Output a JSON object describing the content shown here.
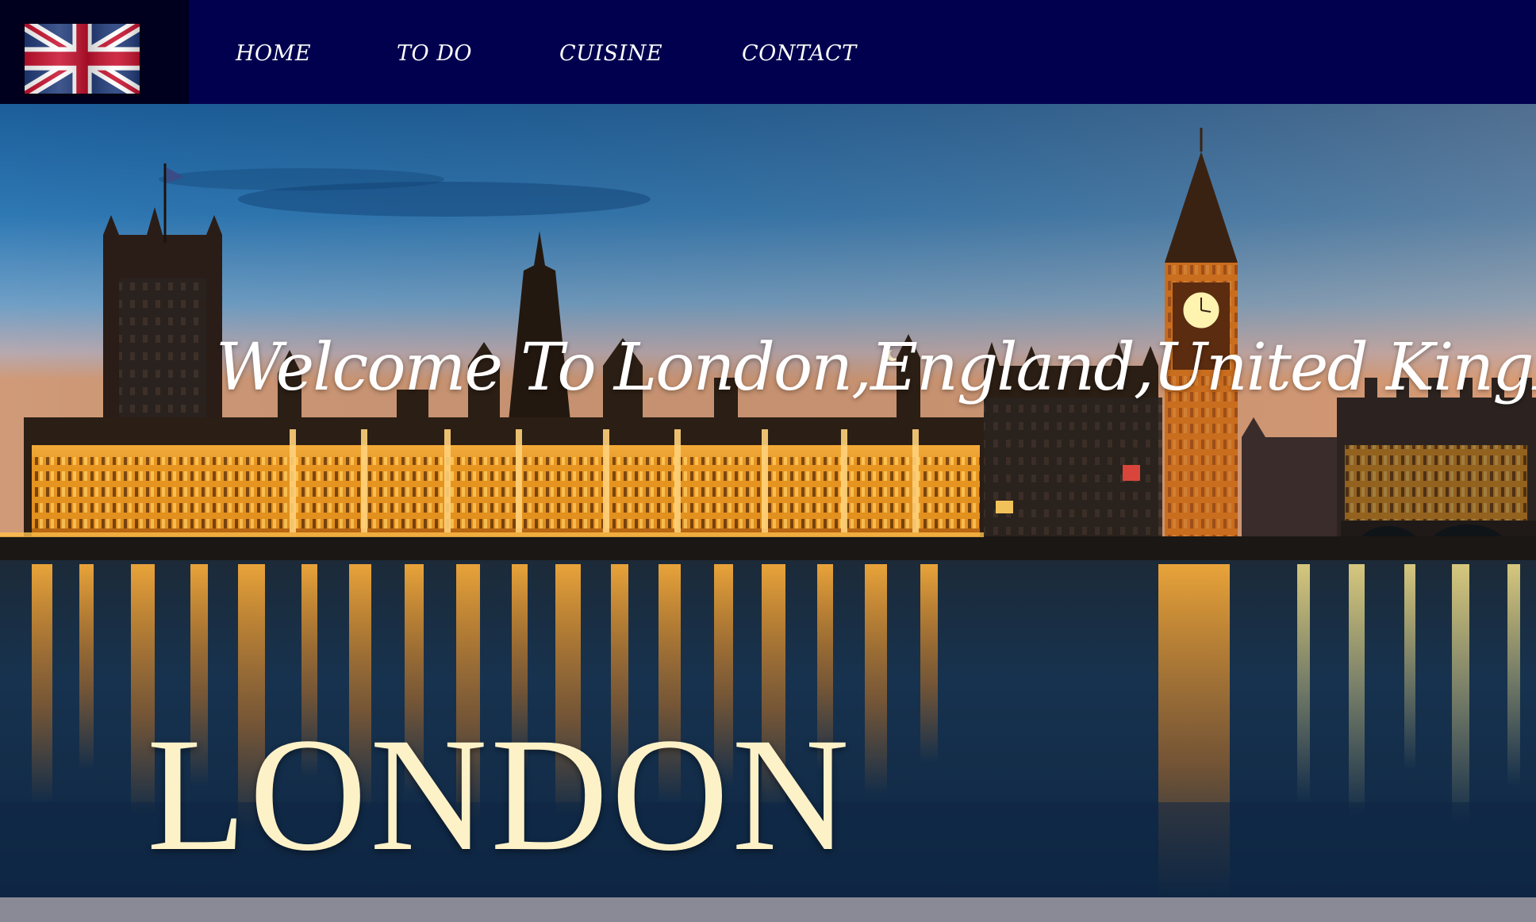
{
  "nav": {
    "logo_icon": "union-jack-flag-icon",
    "items": [
      {
        "label": "HOME"
      },
      {
        "label": "TO DO"
      },
      {
        "label": "CUISINE"
      },
      {
        "label": "CONTACT"
      }
    ]
  },
  "hero": {
    "welcome_text": "Welcome To London,England,United KingDom",
    "big_title": "LONDON",
    "image": "westminster-palace-night-photo"
  },
  "colors": {
    "nav_background": "#00004f",
    "logo_background": "#00001e",
    "footer_strip": "#8a8a96",
    "title_color": "#fdf1c8"
  }
}
